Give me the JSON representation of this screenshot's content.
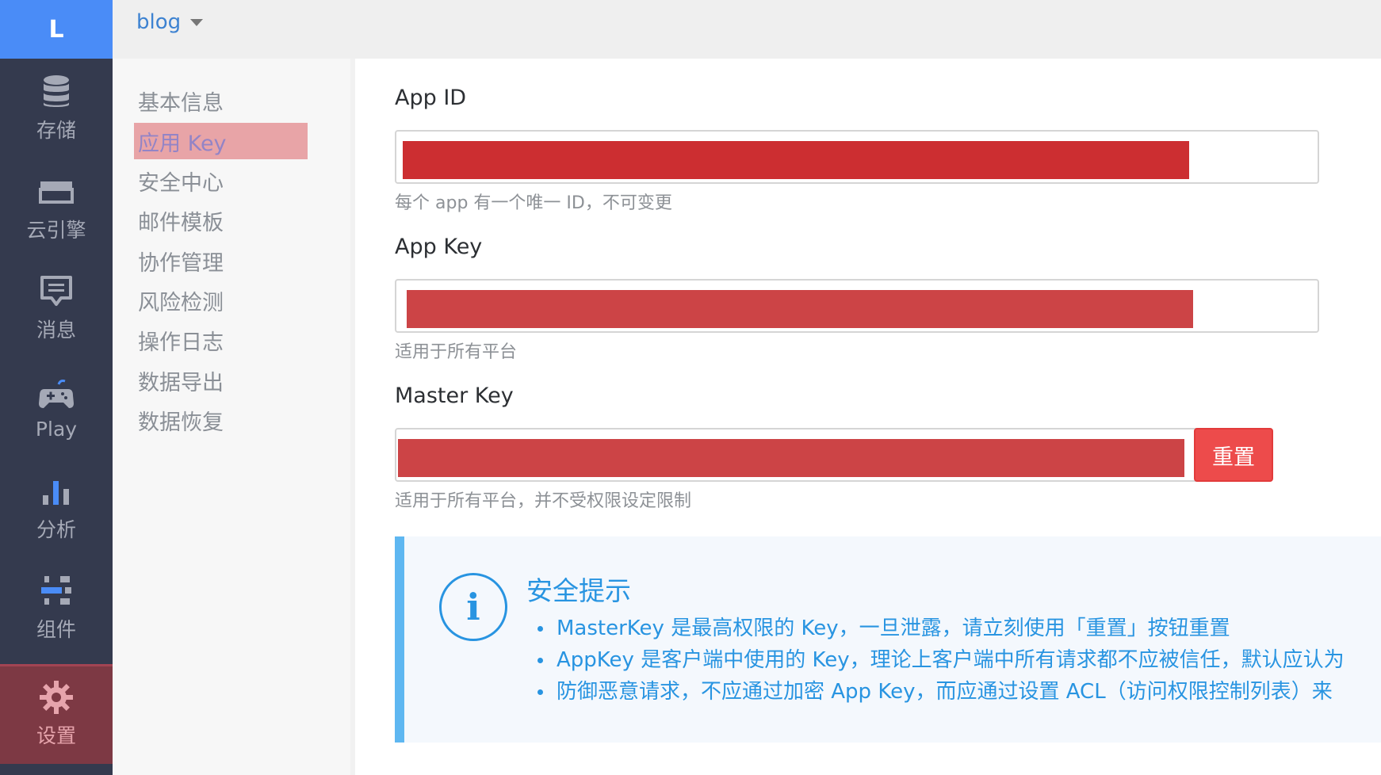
{
  "brand": {
    "logo_letter": "L"
  },
  "header": {
    "app_name": "blog"
  },
  "rail": {
    "items": [
      {
        "id": "storage",
        "label": "存储",
        "icon": "database-icon"
      },
      {
        "id": "engine",
        "label": "云引擎",
        "icon": "server-icon"
      },
      {
        "id": "message",
        "label": "消息",
        "icon": "message-icon"
      },
      {
        "id": "play",
        "label": "Play",
        "icon": "gamepad-icon"
      },
      {
        "id": "analytics",
        "label": "分析",
        "icon": "bar-chart-icon"
      },
      {
        "id": "components",
        "label": "组件",
        "icon": "components-icon"
      },
      {
        "id": "settings",
        "label": "设置",
        "icon": "gear-icon",
        "active": true
      }
    ]
  },
  "subnav": {
    "items": [
      {
        "label": "基本信息"
      },
      {
        "label": "应用 Key",
        "active": true
      },
      {
        "label": "安全中心"
      },
      {
        "label": "邮件模板"
      },
      {
        "label": "协作管理"
      },
      {
        "label": "风险检测"
      },
      {
        "label": "操作日志"
      },
      {
        "label": "数据导出"
      },
      {
        "label": "数据恢复"
      }
    ]
  },
  "fields": {
    "app_id": {
      "label": "App ID",
      "hint": "每个 app 有一个唯一 ID，不可变更"
    },
    "app_key": {
      "label": "App Key",
      "hint": "适用于所有平台"
    },
    "master_key": {
      "label": "Master Key",
      "hint": "适用于所有平台，并不受权限设定限制",
      "button": "重置"
    }
  },
  "tip": {
    "title": "安全提示",
    "items": [
      "MasterKey 是最高权限的 Key，一旦泄露，请立刻使用「重置」按钮重置",
      "AppKey 是客户端中使用的 Key，理论上客户端中所有请求都不应被信任，默认应认为",
      "防御恶意请求，不应通过加密 App Key，而应通过设置 ACL（访问权限控制列表）来"
    ]
  },
  "colors": {
    "accent": "#4a8cf7",
    "rail_bg": "#343a4e",
    "active_rail_bg": "#7d3944",
    "redaction": "#cc2e31",
    "danger_button": "#ed4b4b",
    "tip_text": "#2894e1"
  }
}
